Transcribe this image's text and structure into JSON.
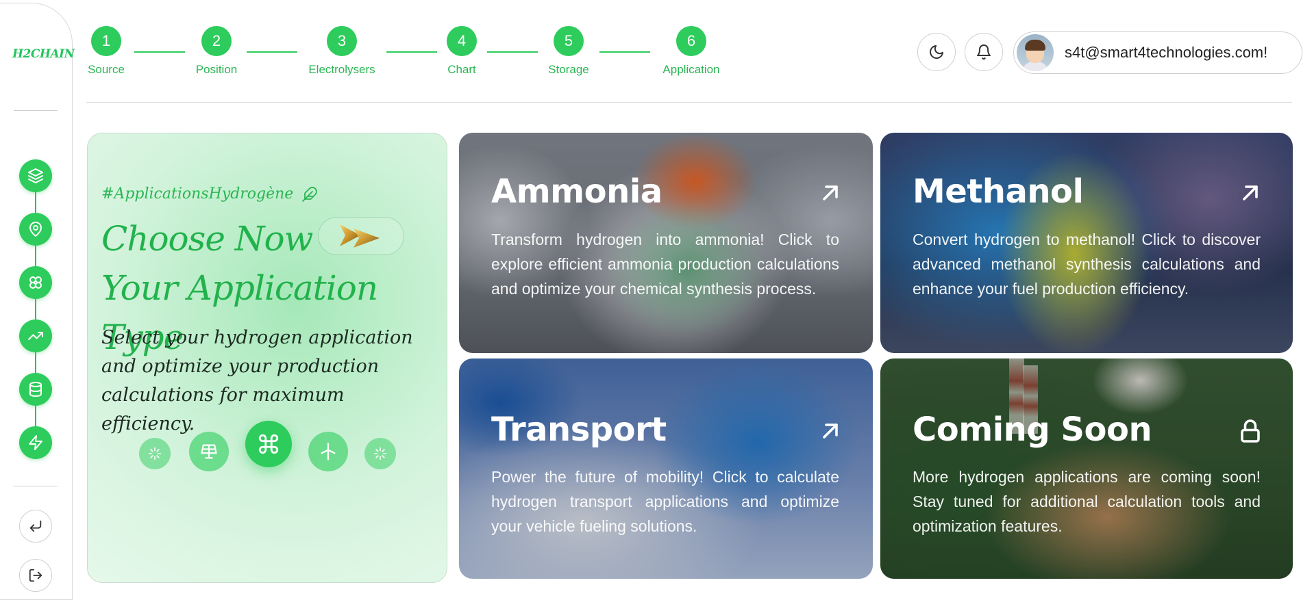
{
  "app": {
    "logo_text": "H2CHAIN"
  },
  "stepper": {
    "steps": [
      {
        "num": "1",
        "label": "Source"
      },
      {
        "num": "2",
        "label": "Position"
      },
      {
        "num": "3",
        "label": "Electrolysers"
      },
      {
        "num": "4",
        "label": "Chart"
      },
      {
        "num": "5",
        "label": "Storage"
      },
      {
        "num": "6",
        "label": "Application"
      }
    ]
  },
  "header": {
    "user_email": "s4t@smart4technologies.com!"
  },
  "sidebar": {
    "items": [
      {
        "icon": "layers-icon"
      },
      {
        "icon": "map-pin-icon"
      },
      {
        "icon": "clover-icon"
      },
      {
        "icon": "trending-up-icon"
      },
      {
        "icon": "database-icon"
      },
      {
        "icon": "zap-icon"
      }
    ],
    "bottom": [
      {
        "icon": "corner-down-left-icon"
      },
      {
        "icon": "log-out-icon"
      }
    ]
  },
  "hero": {
    "tag": "#ApplicationsHydrogène",
    "title_line1": "Choose Now",
    "title_line2": "Your Application Type",
    "description": "Select your hydrogen application and optimize your production calculations for maximum efficiency.",
    "dock_icons": [
      "loader-icon",
      "solar-panel-icon",
      "command-icon",
      "wind-turbine-icon",
      "loader-icon"
    ]
  },
  "cards": [
    {
      "title": "Ammonia",
      "description": "Transform hydrogen into ammonia! Click to explore efficient ammonia production calculations and optimize your chemical synthesis process.",
      "icon": "arrow-up-right-icon"
    },
    {
      "title": "Methanol",
      "description": "Convert hydrogen to methanol! Click to discover advanced methanol synthesis calculations and enhance your fuel production efficiency.",
      "icon": "arrow-up-right-icon"
    },
    {
      "title": "Transport",
      "description": "Power the future of mobility! Click to calculate hydrogen transport applications and optimize your vehicle fueling solutions.",
      "icon": "arrow-up-right-icon"
    },
    {
      "title": "Coming Soon",
      "description": "More hydrogen applications are coming soon! Stay tuned for additional calculation tools and optimization features.",
      "icon": "lock-icon"
    }
  ],
  "colors": {
    "accent": "#2ecc5c",
    "accent_text": "#2bb553"
  }
}
